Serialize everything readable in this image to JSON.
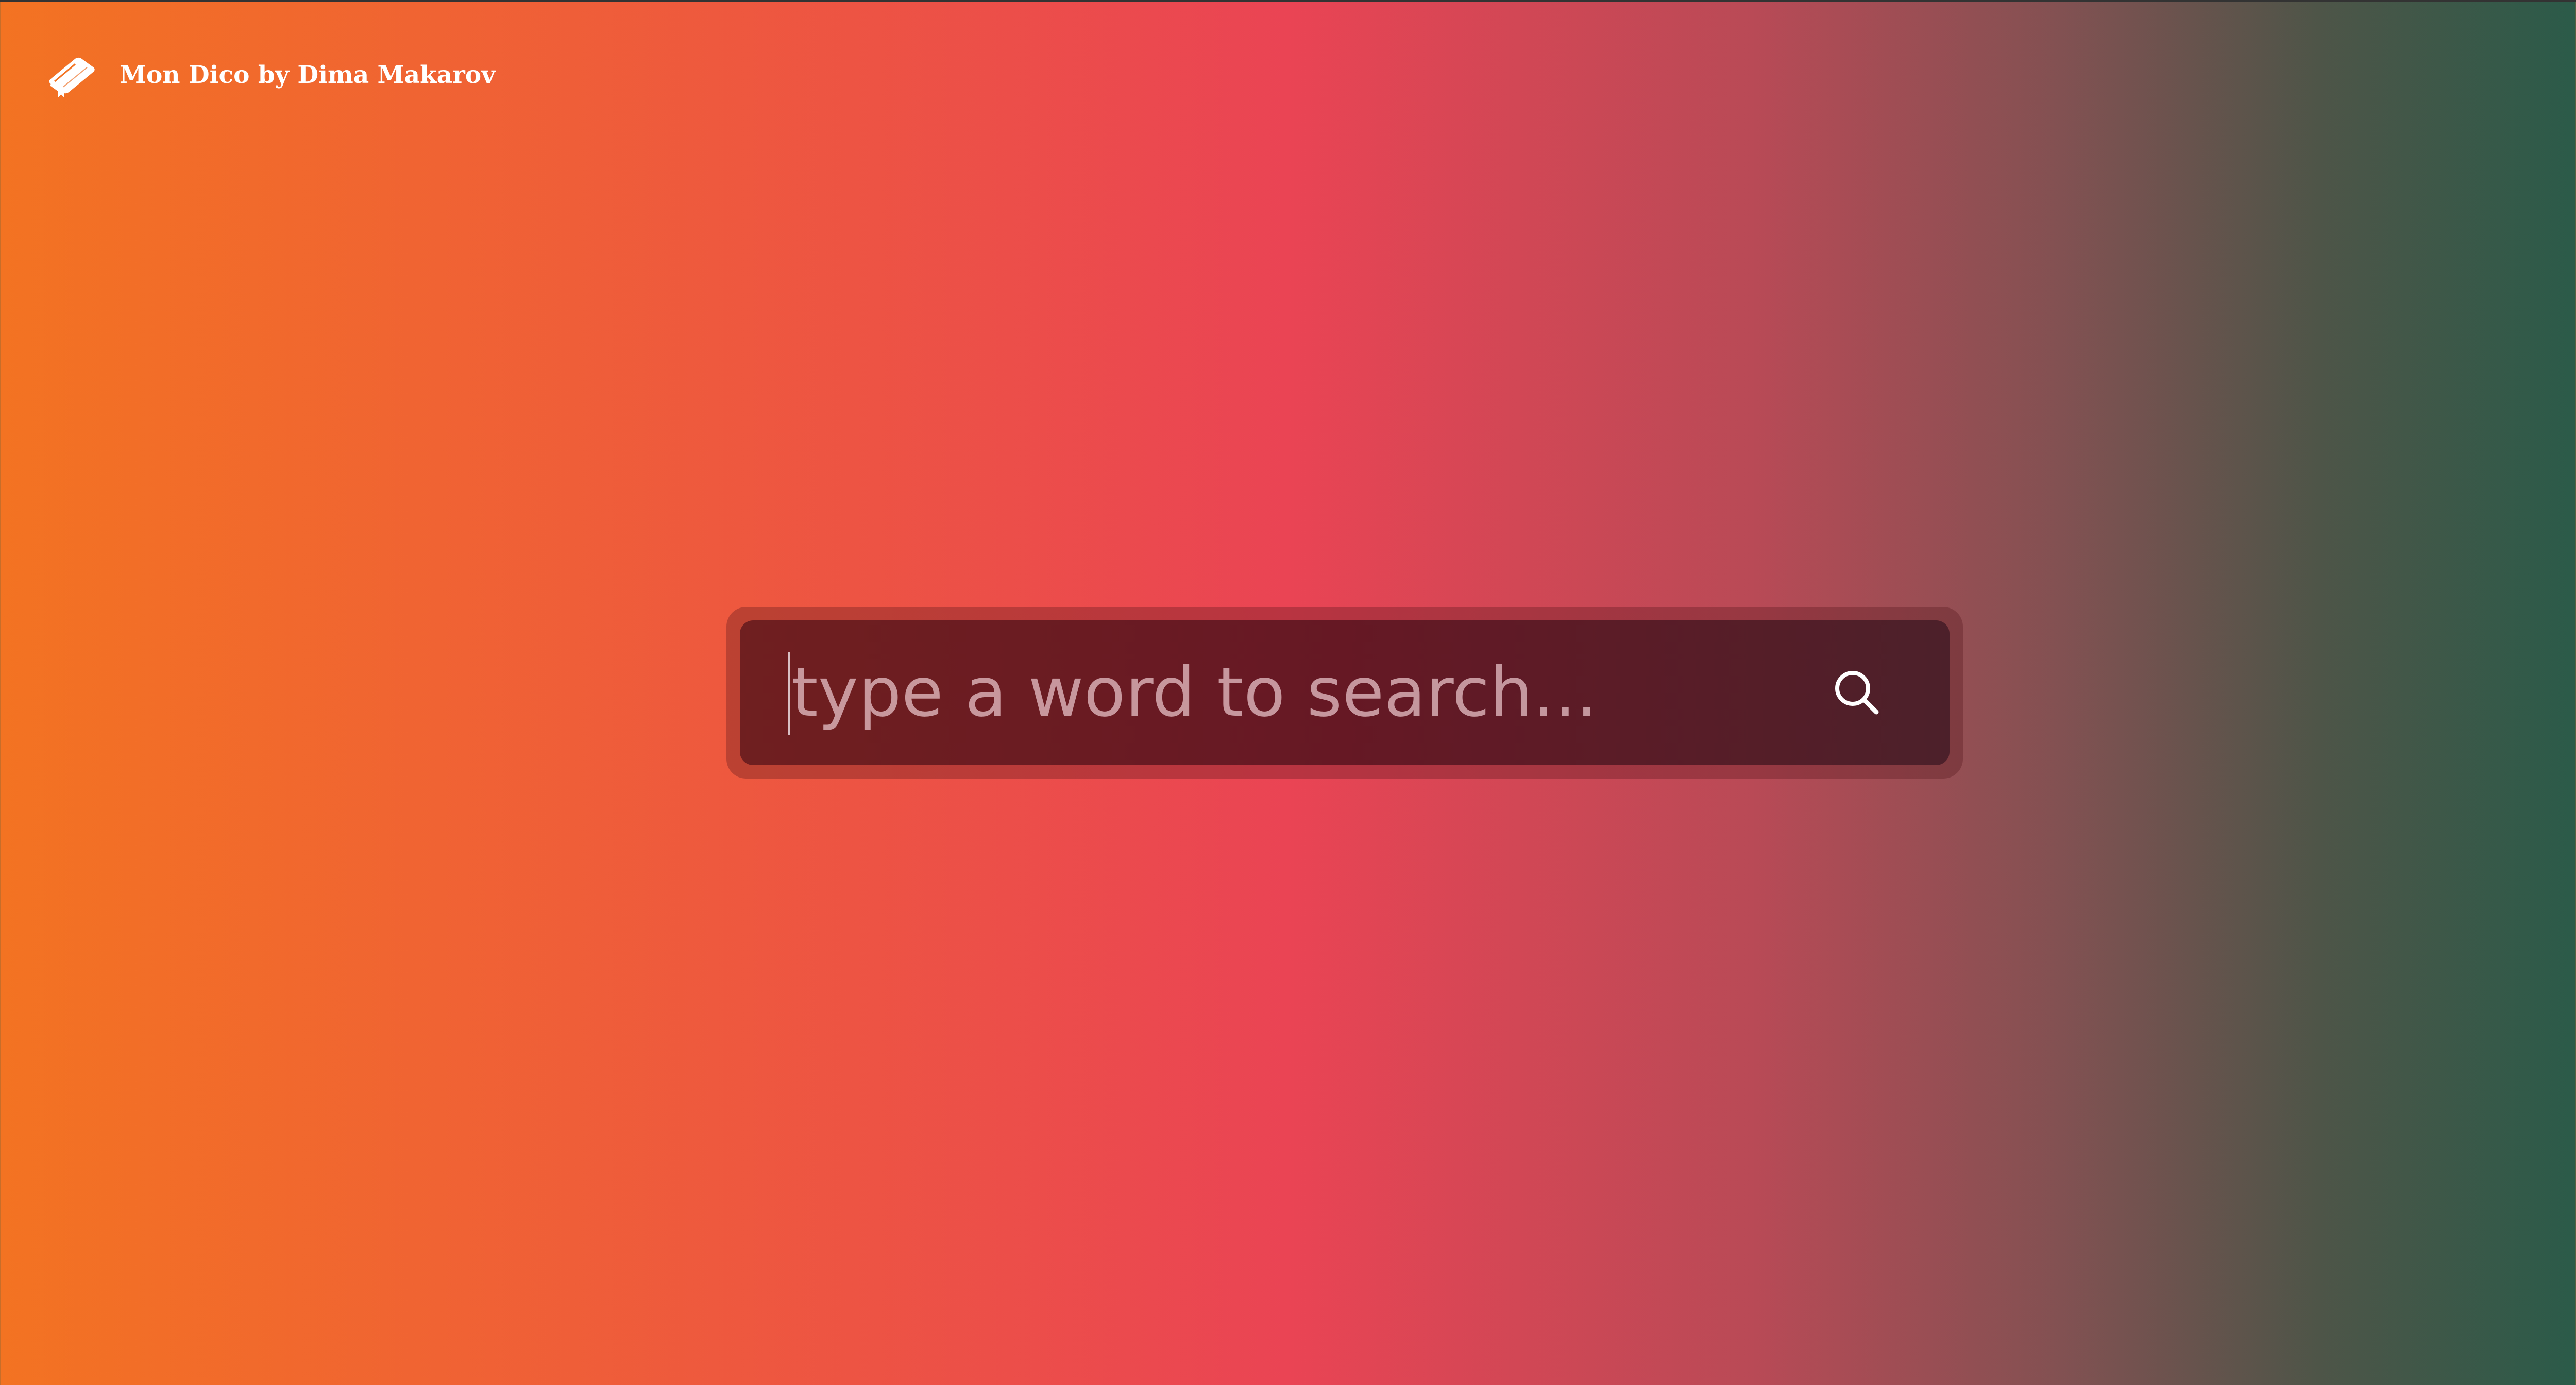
{
  "header": {
    "title": "Mon Dico by Dima Makarov",
    "icon": "book-icon"
  },
  "search": {
    "placeholder": "type a word to search...",
    "value": "",
    "button_icon": "search-icon"
  },
  "colors": {
    "gradient_left": "#f37322",
    "gradient_middle": "#ea4454",
    "gradient_right": "#2b5b49",
    "text": "#ffffff"
  }
}
